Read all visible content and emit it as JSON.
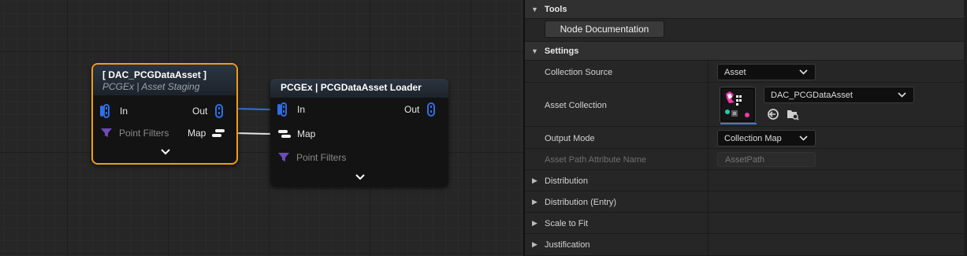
{
  "graph": {
    "node_a": {
      "title": "[ DAC_PCGDataAsset ]",
      "subtitle": "PCGEx | Asset Staging",
      "pins": {
        "in": "In",
        "out": "Out",
        "point_filters": "Point Filters",
        "map": "Map"
      }
    },
    "node_b": {
      "title": "PCGEx | PCGDataAsset Loader",
      "pins": {
        "in": "In",
        "out": "Out",
        "map": "Map",
        "point_filters": "Point Filters"
      }
    },
    "colors": {
      "selection": "#f09c1a",
      "pin_blue": "#2f6ee8",
      "filter_purple": "#6d4bb8",
      "map_white": "#f2f2f2"
    }
  },
  "details": {
    "tools": {
      "label": "Tools",
      "node_documentation": "Node Documentation"
    },
    "settings": {
      "label": "Settings",
      "collection_source": {
        "label": "Collection Source",
        "value": "Asset"
      },
      "asset_collection": {
        "label": "Asset Collection",
        "value": "DAC_PCGDataAsset"
      },
      "output_mode": {
        "label": "Output Mode",
        "value": "Collection Map"
      },
      "asset_path_attribute_name": {
        "label": "Asset Path Attribute Name",
        "placeholder": "AssetPath"
      }
    },
    "groups": [
      "Distribution",
      "Distribution (Entry)",
      "Scale to Fit",
      "Justification"
    ]
  }
}
